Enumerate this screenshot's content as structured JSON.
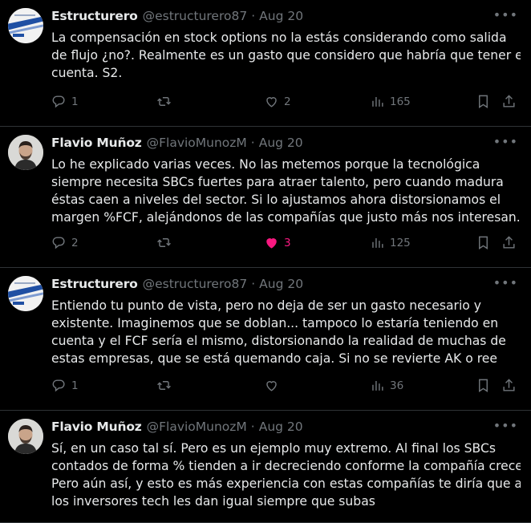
{
  "tweets": [
    {
      "author": "Estructurero",
      "handle": "@estructurero87",
      "date": "Aug 20",
      "avatar": "estructurero-logo",
      "lines": [
        "La compensación en stock options no la estás considerando como salida",
        "de flujo ¿no?. Realmente es un gasto que considero que habría que tener en",
        "cuenta. S2."
      ],
      "replies": "1",
      "reposts": "",
      "likes": "2",
      "views": "165",
      "liked": false
    },
    {
      "author": "Flavio Muñoz",
      "handle": "@FlavioMunozM",
      "date": "Aug 20",
      "avatar": "flavio-photo",
      "lines": [
        "Lo he explicado varias veces. No las metemos porque la tecnológica",
        "siempre necesita SBCs fuertes para atraer talento, pero cuando madura",
        "éstas caen a niveles del sector. Si lo ajustamos ahora distorsionamos el",
        "margen %FCF, alejándonos de las compañías que justo más nos interesan."
      ],
      "replies": "2",
      "reposts": "",
      "likes": "3",
      "views": "125",
      "liked": true
    },
    {
      "author": "Estructurero",
      "handle": "@estructurero87",
      "date": "Aug 20",
      "avatar": "estructurero-logo",
      "lines": [
        "Entiendo tu punto de vista, pero no deja de ser un gasto necesario y",
        "existente. Imaginemos que se doblan... tampoco lo estaría teniendo en",
        "cuenta y el FCF sería el mismo, distorsionando la realidad de muchas de",
        "estas empresas, que se está quemando caja. Si no se revierte AK o ree"
      ],
      "replies": "1",
      "reposts": "",
      "likes": "",
      "views": "36",
      "liked": false
    },
    {
      "author": "Flavio Muñoz",
      "handle": "@FlavioMunozM",
      "date": "Aug 20",
      "avatar": "flavio-photo",
      "lines": [
        "Sí, en un caso tal sí. Pero es un ejemplo muy extremo. Al final los SBCs",
        "contados de forma % tienden a ir decreciendo conforme la compañía crece.",
        "Pero aún así, y esto es más experiencia con estas compañías te diría que a",
        "los inversores tech les dan igual siempre que subas"
      ],
      "replies": "",
      "reposts": "",
      "likes": "",
      "views": "",
      "liked": false
    }
  ],
  "icons": {
    "reply": "reply-icon",
    "repost": "repost-icon",
    "like": "heart-icon",
    "views": "views-icon",
    "bookmark": "bookmark-icon",
    "share": "share-icon",
    "more": "more-icon"
  },
  "colors": {
    "background": "#000000",
    "text": "#e7e9ea",
    "muted": "#71767b",
    "like": "#f91880",
    "divider": "#2f3336"
  }
}
